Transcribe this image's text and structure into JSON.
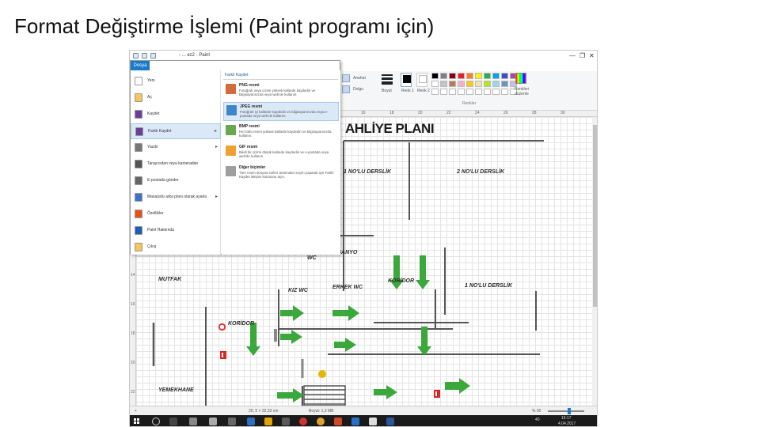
{
  "slide": {
    "title": "Format Değiştirme İşlemi (Paint programı için)"
  },
  "window": {
    "title": "- ... ez2 - Paint",
    "controls": [
      "minimize",
      "maximize",
      "close"
    ]
  },
  "ribbon": {
    "file_tab": "Dosya",
    "buttons": {
      "outline": "Anahat",
      "fill": "Dolgu",
      "size": "Boyut",
      "color1": "Renk 1",
      "color2": "Renk 2",
      "edit_colors": "Renkleri düzenle"
    },
    "group_colors": "Renkler",
    "palette": [
      "#000000",
      "#7f7f7f",
      "#880015",
      "#ed1c24",
      "#ff7f27",
      "#fff200",
      "#22b14c",
      "#00a2e8",
      "#3f48cc",
      "#a349a4",
      "#ffffff",
      "#c3c3c3",
      "#b97a57",
      "#ffaec9",
      "#ffc90e",
      "#efe4b0",
      "#b5e61d",
      "#99d9ea",
      "#7092be",
      "#c8bfe7",
      "#ffffff",
      "#ffffff",
      "#ffffff",
      "#ffffff",
      "#ffffff",
      "#ffffff",
      "#ffffff",
      "#ffffff",
      "#ffffff",
      "#ffffff"
    ]
  },
  "ruler": {
    "marks": [
      "16",
      "18",
      "20",
      "22",
      "24",
      "26",
      "28",
      "30"
    ],
    "side_marks": [
      "12",
      "14",
      "16",
      "18",
      "20",
      "22"
    ]
  },
  "file_menu": {
    "items": [
      {
        "label": "Yeni",
        "icon": "new-file-icon",
        "color": "#ffffff"
      },
      {
        "label": "Aç",
        "icon": "open-folder-icon",
        "color": "#f3c75f"
      },
      {
        "label": "Kaydet",
        "icon": "save-icon",
        "color": "#6a3f9c"
      },
      {
        "label": "Farklı Kaydet",
        "icon": "save-as-icon",
        "color": "#6a3f9c",
        "submenu": true
      },
      {
        "label": "Yazdır",
        "icon": "print-icon",
        "color": "#777777",
        "submenu": true
      },
      {
        "label": "Tarayıcıdan veya kameradan",
        "icon": "scanner-icon",
        "color": "#555555"
      },
      {
        "label": "E-postada gönder",
        "icon": "email-icon",
        "color": "#666666"
      },
      {
        "label": "Masaüstü arka planı olarak ayarla",
        "icon": "desktop-icon",
        "color": "#3b73c9",
        "submenu": true
      },
      {
        "label": "Özellikler",
        "icon": "check-icon",
        "color": "#e5531a"
      },
      {
        "label": "Paint Hakkında",
        "icon": "info-icon",
        "color": "#1e5fb5"
      },
      {
        "label": "Çıkış",
        "icon": "exit-icon",
        "color": "#f2c65a"
      }
    ],
    "save_as_header": "Farklı Kaydet",
    "save_as_formats": [
      {
        "title": "PNG resmi",
        "desc": "Fotoğrafı veya çizimi yüksek kalitede kaydedin ve bilgisayarınızda veya web'de kullanın.",
        "color": "#d46a3a"
      },
      {
        "title": "JPEG resmi",
        "desc": "Fotoğrafı iyi kalitede kaydedin ve bilgisayarınızda veya e-postada veya web'de kullanın.",
        "color": "#3e86c9",
        "selected": true
      },
      {
        "title": "BMP resmi",
        "desc": "Her türlü resmi yüksek kalitede kaydedin ve bilgisayarınızda kullanın.",
        "color": "#6aa84f"
      },
      {
        "title": "GIF resmi",
        "desc": "Basit bir çizimi düşük kalitede kaydedin ve e-postada veya web'de kullanın.",
        "color": "#f0a030"
      },
      {
        "title": "Diğer biçimler",
        "desc": "Tüm resim dosyası türleri arasından seçim yaparak için Farklı Kaydet iletişim kutusunu açın.",
        "color": "#9e9e9e"
      }
    ]
  },
  "plan": {
    "title": "AHLİYE PLANI",
    "labels": {
      "derslik2": "2 NO'LU DERSLİK",
      "derslik_top": "1 NO'LU DERSLİK",
      "derslik1": "1 NO'LU DERSLİK",
      "banyo": "BANYO",
      "wc": "WC",
      "mutfak": "MUTFAK",
      "kiz_wc": "KIZ WC",
      "erkek_wc": "ERKEK WC",
      "koridor1": "KORİDOR",
      "koridor2": "KORİDOR",
      "yemekhane": "YEMEKHANE"
    },
    "arrow_color": "#3aa83a"
  },
  "statusbar": {
    "position": "29, 5 × 32,33 cm",
    "size": "Boyut: 1,3 MB",
    "zoom": "% 00"
  },
  "taskbar": {
    "time": "15:17",
    "date": "4.04.2017",
    "volume": "40"
  }
}
